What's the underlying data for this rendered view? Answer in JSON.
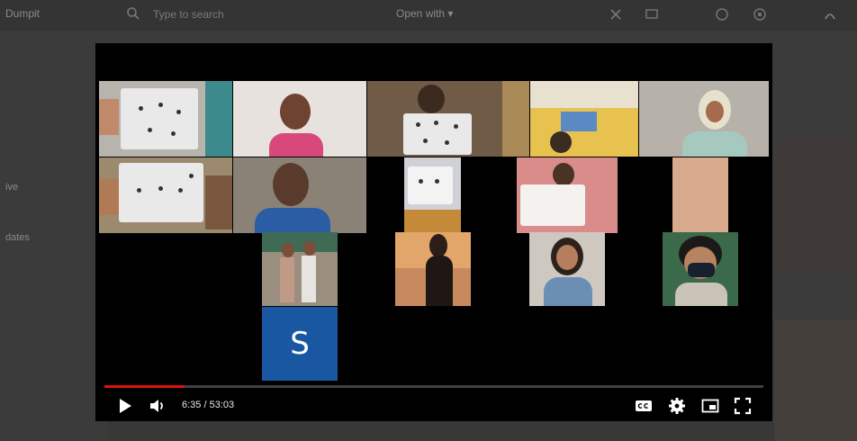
{
  "background_app": {
    "app_name": "Dumpit",
    "search_placeholder": "Type to search",
    "open_with_label": "Open with ▾",
    "side_label_1": "ive",
    "side_label_2": "dates"
  },
  "video": {
    "progress": 0.122,
    "current_time": "6:35",
    "duration": "53:03",
    "time_display": "6:35 / 53:03",
    "avatar_letter": "S",
    "accent_color": "#e11111"
  }
}
